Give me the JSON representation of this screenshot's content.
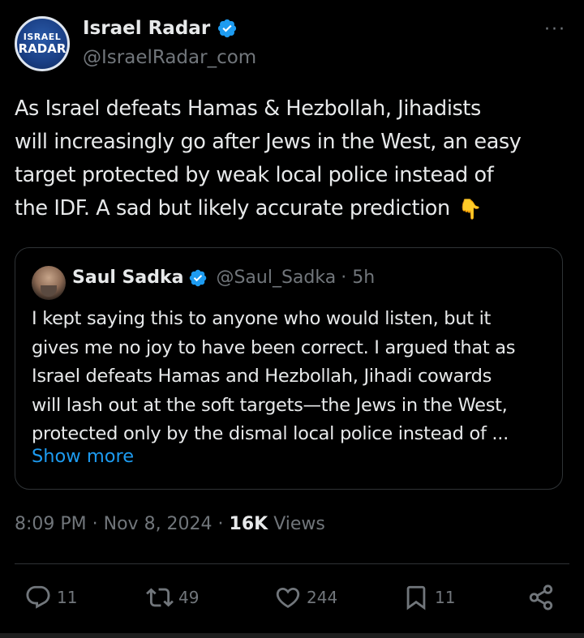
{
  "author": {
    "name": "Israel Radar",
    "handle": "@IsraelRadar_com",
    "avatar_text_top": "ISRAEL",
    "avatar_text_bottom": "RADAR"
  },
  "more_icon": "more-horizontal-icon",
  "tweet": {
    "text_lines": [
      "As Israel defeats Hamas & Hezbollah, Jihadists",
      "will increasingly go after Jews in the West, an easy",
      "target protected by weak local police instead of",
      "the IDF. A sad but likely accurate prediction"
    ],
    "emoji": "👇"
  },
  "quote": {
    "name": "Saul Sadka",
    "handle": "@Saul_Sadka",
    "time": "· 5h",
    "text_lines": [
      "I kept saying this to anyone who would listen, but it",
      "gives me no joy to have been correct. I argued that as",
      "Israel defeats Hamas and Hezbollah, Jihadi cowards",
      "will lash out at the soft targets—the Jews in the West,",
      "protected only by the dismal local police instead of ..."
    ],
    "show_more": "Show more"
  },
  "meta": {
    "time": "8:09 PM",
    "sep1": " · ",
    "date": "Nov 8, 2024",
    "sep2": " · ",
    "views_count": "16K",
    "views_label": " Views"
  },
  "actions": {
    "replies": "11",
    "reposts": "49",
    "likes": "244",
    "bookmarks": "11"
  },
  "colors": {
    "background": "#000000",
    "text": "#e7e9ea",
    "secondary": "#71767b",
    "link": "#1d9bf0",
    "verified": "#1d9bf0",
    "border": "#2f3336"
  }
}
